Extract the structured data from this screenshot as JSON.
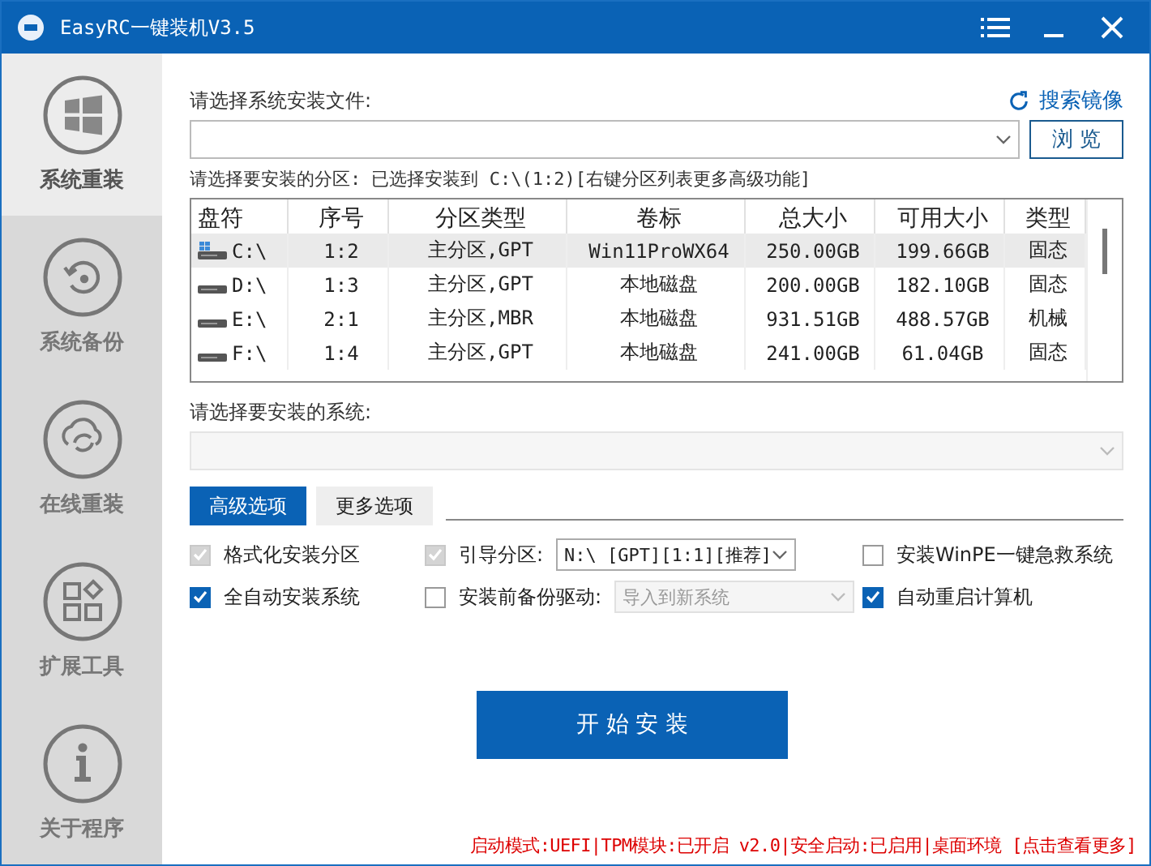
{
  "window": {
    "title": "EasyRC一键装机V3.5"
  },
  "sidebar": {
    "items": [
      {
        "label": "系统重装",
        "selected": true
      },
      {
        "label": "系统备份",
        "selected": false
      },
      {
        "label": "在线重装",
        "selected": false
      },
      {
        "label": "扩展工具",
        "selected": false
      },
      {
        "label": "关于程序",
        "selected": false
      }
    ]
  },
  "file_label": "请选择系统安装文件:",
  "search_image_link": "搜索镜像",
  "browse_button": "浏 览",
  "partition_label": "请选择要安装的分区: 已选择安装到 C:\\(1:2)[右键分区列表更多高级功能]",
  "table": {
    "columns": [
      "盘符",
      "序号",
      "分区类型",
      "卷标",
      "总大小",
      "可用大小",
      "类型"
    ],
    "rows": [
      {
        "selected": true,
        "system": true,
        "cells": [
          "C:\\",
          "1:2",
          "主分区,GPT",
          "Win11ProWX64",
          "250.00GB",
          "199.66GB",
          "固态"
        ]
      },
      {
        "selected": false,
        "system": false,
        "cells": [
          "D:\\",
          "1:3",
          "主分区,GPT",
          "本地磁盘",
          "200.00GB",
          "182.10GB",
          "固态"
        ]
      },
      {
        "selected": false,
        "system": false,
        "cells": [
          "E:\\",
          "2:1",
          "主分区,MBR",
          "本地磁盘",
          "931.51GB",
          "488.57GB",
          "机械"
        ]
      },
      {
        "selected": false,
        "system": false,
        "cells": [
          "F:\\",
          "1:4",
          "主分区,GPT",
          "本地磁盘",
          "241.00GB",
          "61.04GB",
          "固态"
        ]
      }
    ]
  },
  "system_label": "请选择要安装的系统:",
  "system_select": {
    "disabled": true
  },
  "option_tabs": [
    {
      "label": "高级选项",
      "selected": true
    },
    {
      "label": "更多选项",
      "selected": false
    }
  ],
  "options": [
    {
      "kind": "checkbox",
      "label": "格式化安装分区",
      "checked": true,
      "disabled": true
    },
    {
      "kind": "checkbox_select",
      "label": "引导分区:",
      "checked": true,
      "disabled": true,
      "select": {
        "value": "N:\\ [GPT][1:1][推荐]",
        "disabled": false
      }
    },
    {
      "kind": "checkbox",
      "label": "安装WinPE一键急救系统",
      "checked": false,
      "disabled": false
    },
    {
      "kind": "checkbox",
      "label": "全自动安装系统",
      "checked": true,
      "disabled": false
    },
    {
      "kind": "checkbox_select",
      "label": "安装前备份驱动:",
      "checked": false,
      "disabled": false,
      "select": {
        "value": "导入到新系统",
        "disabled": true
      }
    },
    {
      "kind": "checkbox",
      "label": "自动重启计算机",
      "checked": true,
      "disabled": false
    }
  ],
  "start_button": "开 始 安 装",
  "status_bar": "启动模式:UEFI|TPM模块:已开启 v2.0|安全启动:已启用|桌面环境 [点击查看更多]"
}
